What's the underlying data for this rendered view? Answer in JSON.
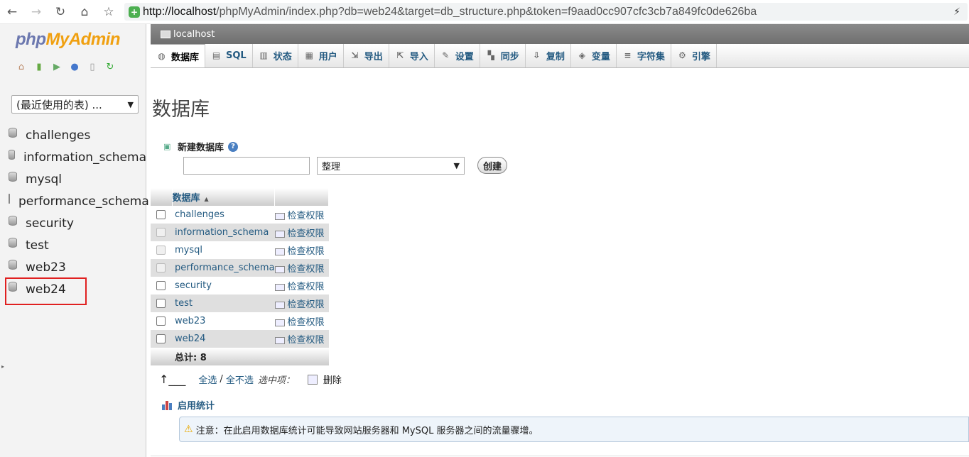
{
  "browser": {
    "url_host": "http://localhost",
    "url_path": "/phpMyAdmin/index.php?db=web24&target=db_structure.php&token=f9aad0cc907cfc3cb7a849fc0de626ba"
  },
  "sidebar": {
    "recent_tables": "(最近使用的表) ...",
    "databases": [
      "challenges",
      "information_schema",
      "mysql",
      "performance_schema",
      "security",
      "test",
      "web23",
      "web24"
    ],
    "highlighted": "web24"
  },
  "server_bar": {
    "label": "localhost"
  },
  "tabs": [
    {
      "label": "数据库",
      "icon": "database-icon"
    },
    {
      "label": "SQL",
      "icon": "sql-icon"
    },
    {
      "label": "状态",
      "icon": "status-icon"
    },
    {
      "label": "用户",
      "icon": "users-icon"
    },
    {
      "label": "导出",
      "icon": "export-icon"
    },
    {
      "label": "导入",
      "icon": "import-icon"
    },
    {
      "label": "设置",
      "icon": "settings-icon"
    },
    {
      "label": "同步",
      "icon": "sync-icon"
    },
    {
      "label": "复制",
      "icon": "replication-icon"
    },
    {
      "label": "变量",
      "icon": "variables-icon"
    },
    {
      "label": "字符集",
      "icon": "charset-icon"
    },
    {
      "label": "引擎",
      "icon": "engine-icon"
    }
  ],
  "page": {
    "title": "数据库",
    "create_db_label": "新建数据库",
    "collation_value": "整理",
    "create_button": "创建",
    "table_header": "数据库",
    "privileges_label": "检查权限",
    "total_label": "总计: 8",
    "check_all": "全选",
    "separator": "/",
    "uncheck_all": "全不选",
    "with_selected": "选中项：",
    "delete": "删除",
    "enable_stats": "启用统计",
    "notice": "注意：在此启用数据库统计可能导致网站服务器和 MySQL 服务器之间的流量骤增。"
  },
  "db_rows": [
    {
      "name": "challenges",
      "disabled": false
    },
    {
      "name": "information_schema",
      "disabled": true
    },
    {
      "name": "mysql",
      "disabled": true
    },
    {
      "name": "performance_schema",
      "disabled": true
    },
    {
      "name": "security",
      "disabled": false
    },
    {
      "name": "test",
      "disabled": false
    },
    {
      "name": "web23",
      "disabled": false
    },
    {
      "name": "web24",
      "disabled": false
    }
  ]
}
